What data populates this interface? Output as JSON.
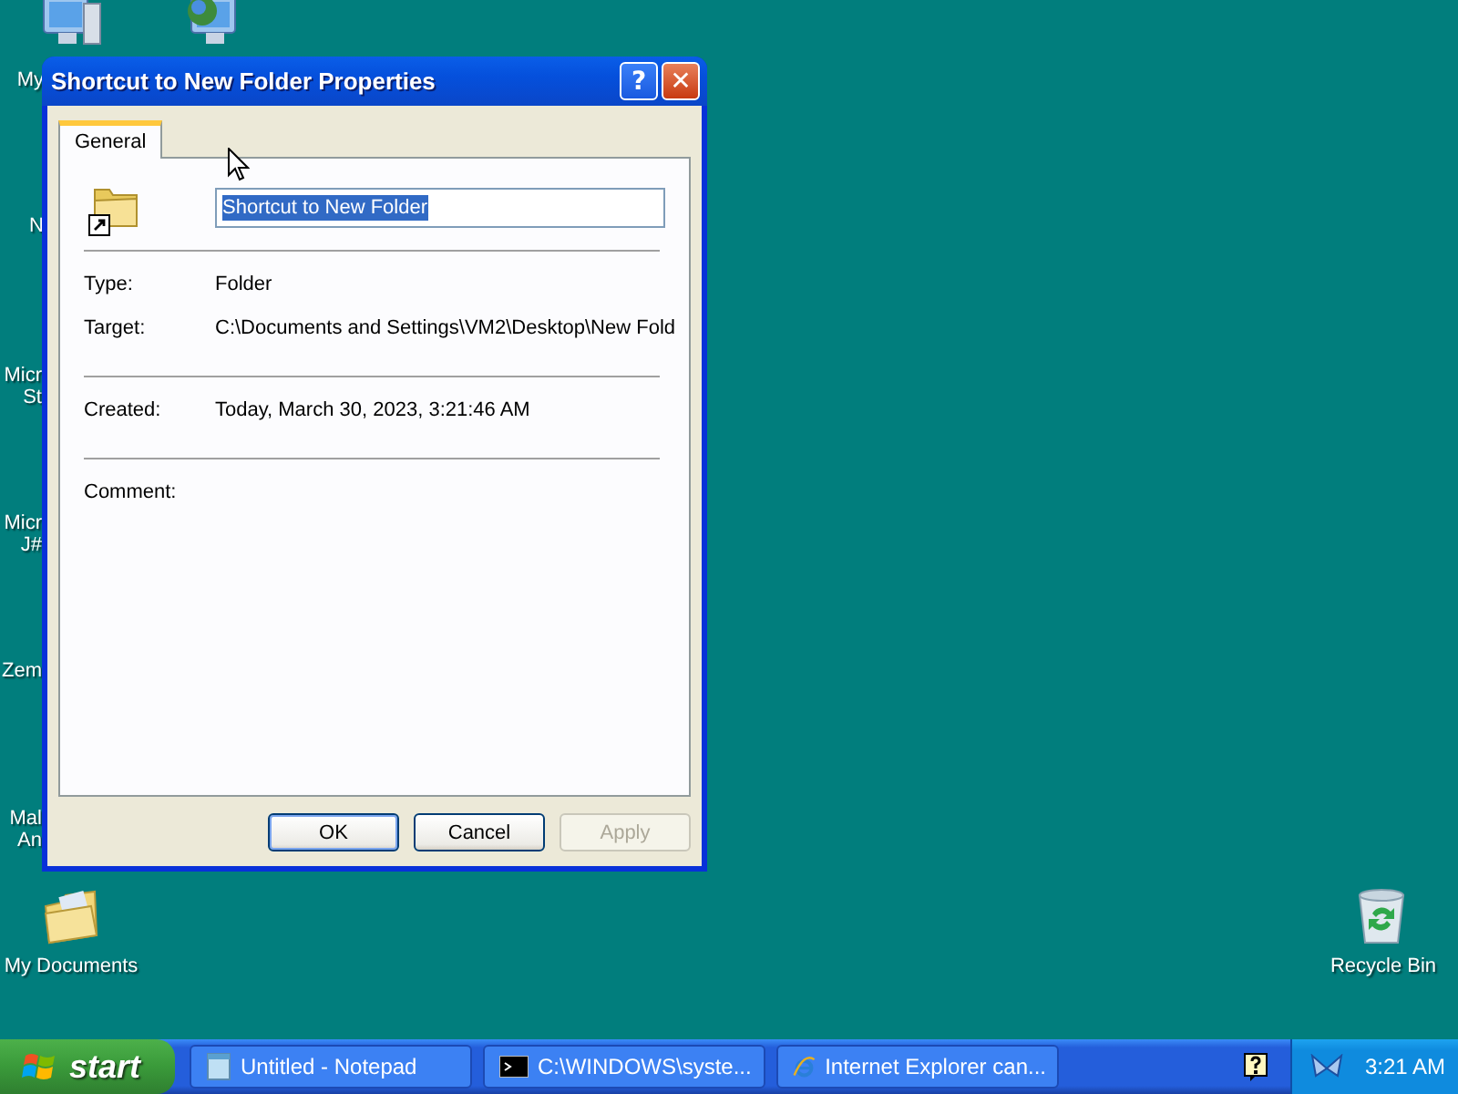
{
  "desktop": {
    "icons": [
      {
        "kind": "computer",
        "label": "My"
      },
      {
        "kind": "network-computer"
      },
      {
        "kind": "cut",
        "label": "N"
      },
      {
        "kind": "cut",
        "label": "Micr\nSt"
      },
      {
        "kind": "cut",
        "label": "Micr\nJ#"
      },
      {
        "kind": "cut",
        "label": "Zem"
      },
      {
        "kind": "cut",
        "label": "Mal\nAn"
      },
      {
        "kind": "documents",
        "label": "My Documents"
      },
      {
        "kind": "recycle-bin",
        "label": "Recycle Bin"
      }
    ]
  },
  "window": {
    "title": "Shortcut to New Folder Properties",
    "help_button": "?",
    "close_button": "✕",
    "tabs": [
      {
        "label": "General",
        "selected": true
      }
    ],
    "name_field": {
      "value": "Shortcut to New Folder",
      "selected": true
    },
    "groups": [
      [
        {
          "label": "Type:",
          "value": "Folder"
        },
        {
          "label": "Target:",
          "value": "C:\\Documents and Settings\\VM2\\Desktop\\New Fold"
        }
      ],
      [
        {
          "label": "Created:",
          "value": "Today, March 30, 2023, 3:21:46 AM"
        }
      ],
      [
        {
          "label": "Comment:"
        }
      ]
    ],
    "buttons": [
      {
        "label": "OK",
        "default": true,
        "disabled": false
      },
      {
        "label": "Cancel",
        "default": false,
        "disabled": false
      },
      {
        "label": "Apply",
        "default": false,
        "disabled": true
      }
    ]
  },
  "taskbar": {
    "start": "start",
    "tasks": [
      {
        "kind": "notepad",
        "label": "Untitled - Notepad"
      },
      {
        "kind": "console",
        "label": "C:\\WINDOWS\\syste..."
      },
      {
        "kind": "browser",
        "label": "Internet Explorer can..."
      }
    ],
    "clock": "3:21 AM"
  }
}
